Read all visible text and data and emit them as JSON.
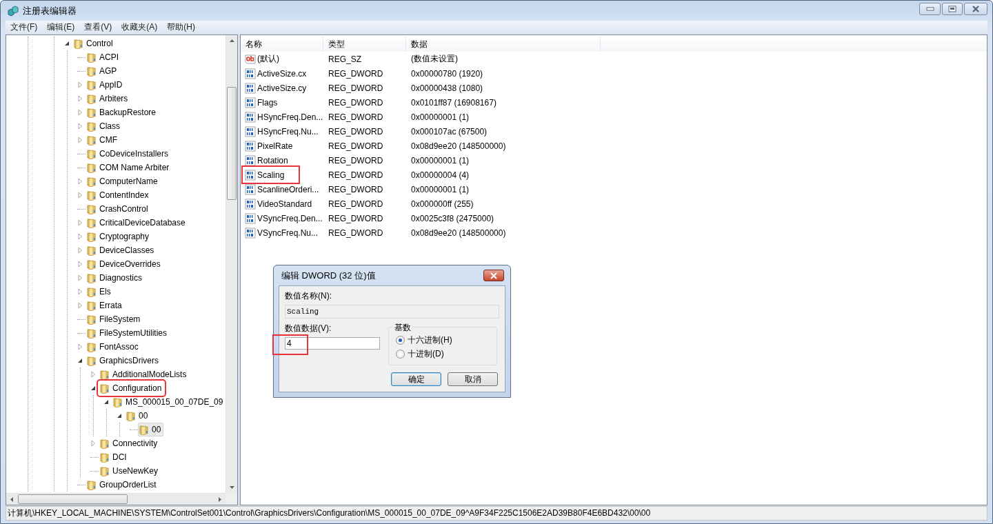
{
  "window": {
    "title": "注册表编辑器"
  },
  "menu": [
    {
      "label": "文件(F)"
    },
    {
      "label": "编辑(E)"
    },
    {
      "label": "查看(V)"
    },
    {
      "label": "收藏夹(A)"
    },
    {
      "label": "帮助(H)"
    }
  ],
  "tree": [
    {
      "label": "Control",
      "kind": "expanded",
      "selected": false,
      "highlighted": false,
      "children": [
        {
          "label": "ACPI",
          "kind": "leaf",
          "selected": false,
          "highlighted": false
        },
        {
          "label": "AGP",
          "kind": "leaf",
          "selected": false,
          "highlighted": false
        },
        {
          "label": "AppID",
          "kind": "collapsed",
          "selected": false,
          "highlighted": false
        },
        {
          "label": "Arbiters",
          "kind": "collapsed",
          "selected": false,
          "highlighted": false
        },
        {
          "label": "BackupRestore",
          "kind": "collapsed",
          "selected": false,
          "highlighted": false
        },
        {
          "label": "Class",
          "kind": "collapsed",
          "selected": false,
          "highlighted": false
        },
        {
          "label": "CMF",
          "kind": "collapsed",
          "selected": false,
          "highlighted": false
        },
        {
          "label": "CoDeviceInstallers",
          "kind": "leaf",
          "selected": false,
          "highlighted": false
        },
        {
          "label": "COM Name Arbiter",
          "kind": "leaf",
          "selected": false,
          "highlighted": false
        },
        {
          "label": "ComputerName",
          "kind": "collapsed",
          "selected": false,
          "highlighted": false
        },
        {
          "label": "ContentIndex",
          "kind": "collapsed",
          "selected": false,
          "highlighted": false
        },
        {
          "label": "CrashControl",
          "kind": "leaf",
          "selected": false,
          "highlighted": false
        },
        {
          "label": "CriticalDeviceDatabase",
          "kind": "collapsed",
          "selected": false,
          "highlighted": false
        },
        {
          "label": "Cryptography",
          "kind": "collapsed",
          "selected": false,
          "highlighted": false
        },
        {
          "label": "DeviceClasses",
          "kind": "collapsed",
          "selected": false,
          "highlighted": false
        },
        {
          "label": "DeviceOverrides",
          "kind": "collapsed",
          "selected": false,
          "highlighted": false
        },
        {
          "label": "Diagnostics",
          "kind": "collapsed",
          "selected": false,
          "highlighted": false
        },
        {
          "label": "Els",
          "kind": "collapsed",
          "selected": false,
          "highlighted": false
        },
        {
          "label": "Errata",
          "kind": "collapsed",
          "selected": false,
          "highlighted": false
        },
        {
          "label": "FileSystem",
          "kind": "leaf",
          "selected": false,
          "highlighted": false
        },
        {
          "label": "FileSystemUtilities",
          "kind": "leaf",
          "selected": false,
          "highlighted": false
        },
        {
          "label": "FontAssoc",
          "kind": "collapsed",
          "selected": false,
          "highlighted": false
        },
        {
          "label": "GraphicsDrivers",
          "kind": "expanded",
          "selected": false,
          "highlighted": false,
          "children": [
            {
              "label": "AdditionalModeLists",
              "kind": "collapsed",
              "selected": false,
              "highlighted": false
            },
            {
              "label": "Configuration",
              "kind": "expanded",
              "selected": false,
              "highlighted": true,
              "children": [
                {
                  "label": "MS_000015_00_07DE_09",
                  "kind": "expanded",
                  "selected": false,
                  "highlighted": false,
                  "children": [
                    {
                      "label": "00",
                      "kind": "expanded",
                      "selected": false,
                      "highlighted": false,
                      "children": [
                        {
                          "label": "00",
                          "kind": "leaf",
                          "selected": true,
                          "highlighted": false
                        }
                      ]
                    }
                  ]
                }
              ]
            },
            {
              "label": "Connectivity",
              "kind": "collapsed",
              "selected": false,
              "highlighted": false
            },
            {
              "label": "DCI",
              "kind": "leaf",
              "selected": false,
              "highlighted": false
            },
            {
              "label": "UseNewKey",
              "kind": "leaf",
              "selected": false,
              "highlighted": false
            }
          ]
        },
        {
          "label": "GroupOrderList",
          "kind": "leaf",
          "selected": false,
          "highlighted": false
        }
      ]
    }
  ],
  "list": {
    "columns": [
      "名称",
      "类型",
      "数据"
    ],
    "rows": [
      {
        "kind": "string",
        "name": "(默认)",
        "type": "REG_SZ",
        "data": "(数值未设置)",
        "highlighted": false
      },
      {
        "kind": "dword",
        "name": "ActiveSize.cx",
        "type": "REG_DWORD",
        "data": "0x00000780 (1920)",
        "highlighted": false
      },
      {
        "kind": "dword",
        "name": "ActiveSize.cy",
        "type": "REG_DWORD",
        "data": "0x00000438 (1080)",
        "highlighted": false
      },
      {
        "kind": "dword",
        "name": "Flags",
        "type": "REG_DWORD",
        "data": "0x0101ff87 (16908167)",
        "highlighted": false
      },
      {
        "kind": "dword",
        "name": "HSyncFreq.Den...",
        "type": "REG_DWORD",
        "data": "0x00000001 (1)",
        "highlighted": false
      },
      {
        "kind": "dword",
        "name": "HSyncFreq.Nu...",
        "type": "REG_DWORD",
        "data": "0x000107ac (67500)",
        "highlighted": false
      },
      {
        "kind": "dword",
        "name": "PixelRate",
        "type": "REG_DWORD",
        "data": "0x08d9ee20 (148500000)",
        "highlighted": false
      },
      {
        "kind": "dword",
        "name": "Rotation",
        "type": "REG_DWORD",
        "data": "0x00000001 (1)",
        "highlighted": false
      },
      {
        "kind": "dword",
        "name": "Scaling",
        "type": "REG_DWORD",
        "data": "0x00000004 (4)",
        "highlighted": true
      },
      {
        "kind": "dword",
        "name": "ScanlineOrderi...",
        "type": "REG_DWORD",
        "data": "0x00000001 (1)",
        "highlighted": false
      },
      {
        "kind": "dword",
        "name": "VideoStandard",
        "type": "REG_DWORD",
        "data": "0x000000ff (255)",
        "highlighted": false
      },
      {
        "kind": "dword",
        "name": "VSyncFreq.Den...",
        "type": "REG_DWORD",
        "data": "0x0025c3f8 (2475000)",
        "highlighted": false
      },
      {
        "kind": "dword",
        "name": "VSyncFreq.Nu...",
        "type": "REG_DWORD",
        "data": "0x08d9ee20 (148500000)",
        "highlighted": false
      }
    ]
  },
  "dialog": {
    "title": "编辑 DWORD (32 位)值",
    "name_label": "数值名称(N):",
    "name_value": "Scaling",
    "data_label": "数值数据(V):",
    "data_value": "4",
    "data_highlighted": true,
    "base_label": "基数",
    "radios": [
      {
        "label": "十六进制(H)",
        "selected": true
      },
      {
        "label": "十进制(D)",
        "selected": false
      }
    ],
    "buttons": [
      {
        "label": "确定",
        "default": true
      },
      {
        "label": "取消",
        "default": false
      }
    ]
  },
  "status_bar": "计算机\\HKEY_LOCAL_MACHINE\\SYSTEM\\ControlSet001\\Control\\GraphicsDrivers\\Configuration\\MS_000015_00_07DE_09^A9F34F225C1506E2AD39B80F4E6BD432\\00\\00"
}
